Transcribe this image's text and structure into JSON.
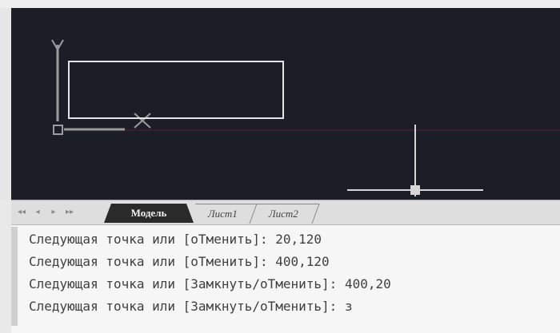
{
  "tabs": {
    "nav": [
      "◂◂",
      "◂",
      "▸",
      "▸▸"
    ],
    "model": "Модель",
    "sheet1": "Лист1",
    "sheet2": "Лист2"
  },
  "ucs": {
    "y_label": "Y"
  },
  "command_history": [
    "Следующая точка или [оТменить]: 20,120",
    "Следующая точка или [оТменить]: 400,120",
    "Следующая точка или [Замкнуть/оТменить]: 400,20",
    "Следующая точка или [Замкнуть/оТменить]: з"
  ],
  "colors": {
    "background": "#1c1e27",
    "drawing": "#e6e6e6",
    "crosshair": "#d6d6d6",
    "axis_marker": "#5a2330"
  }
}
